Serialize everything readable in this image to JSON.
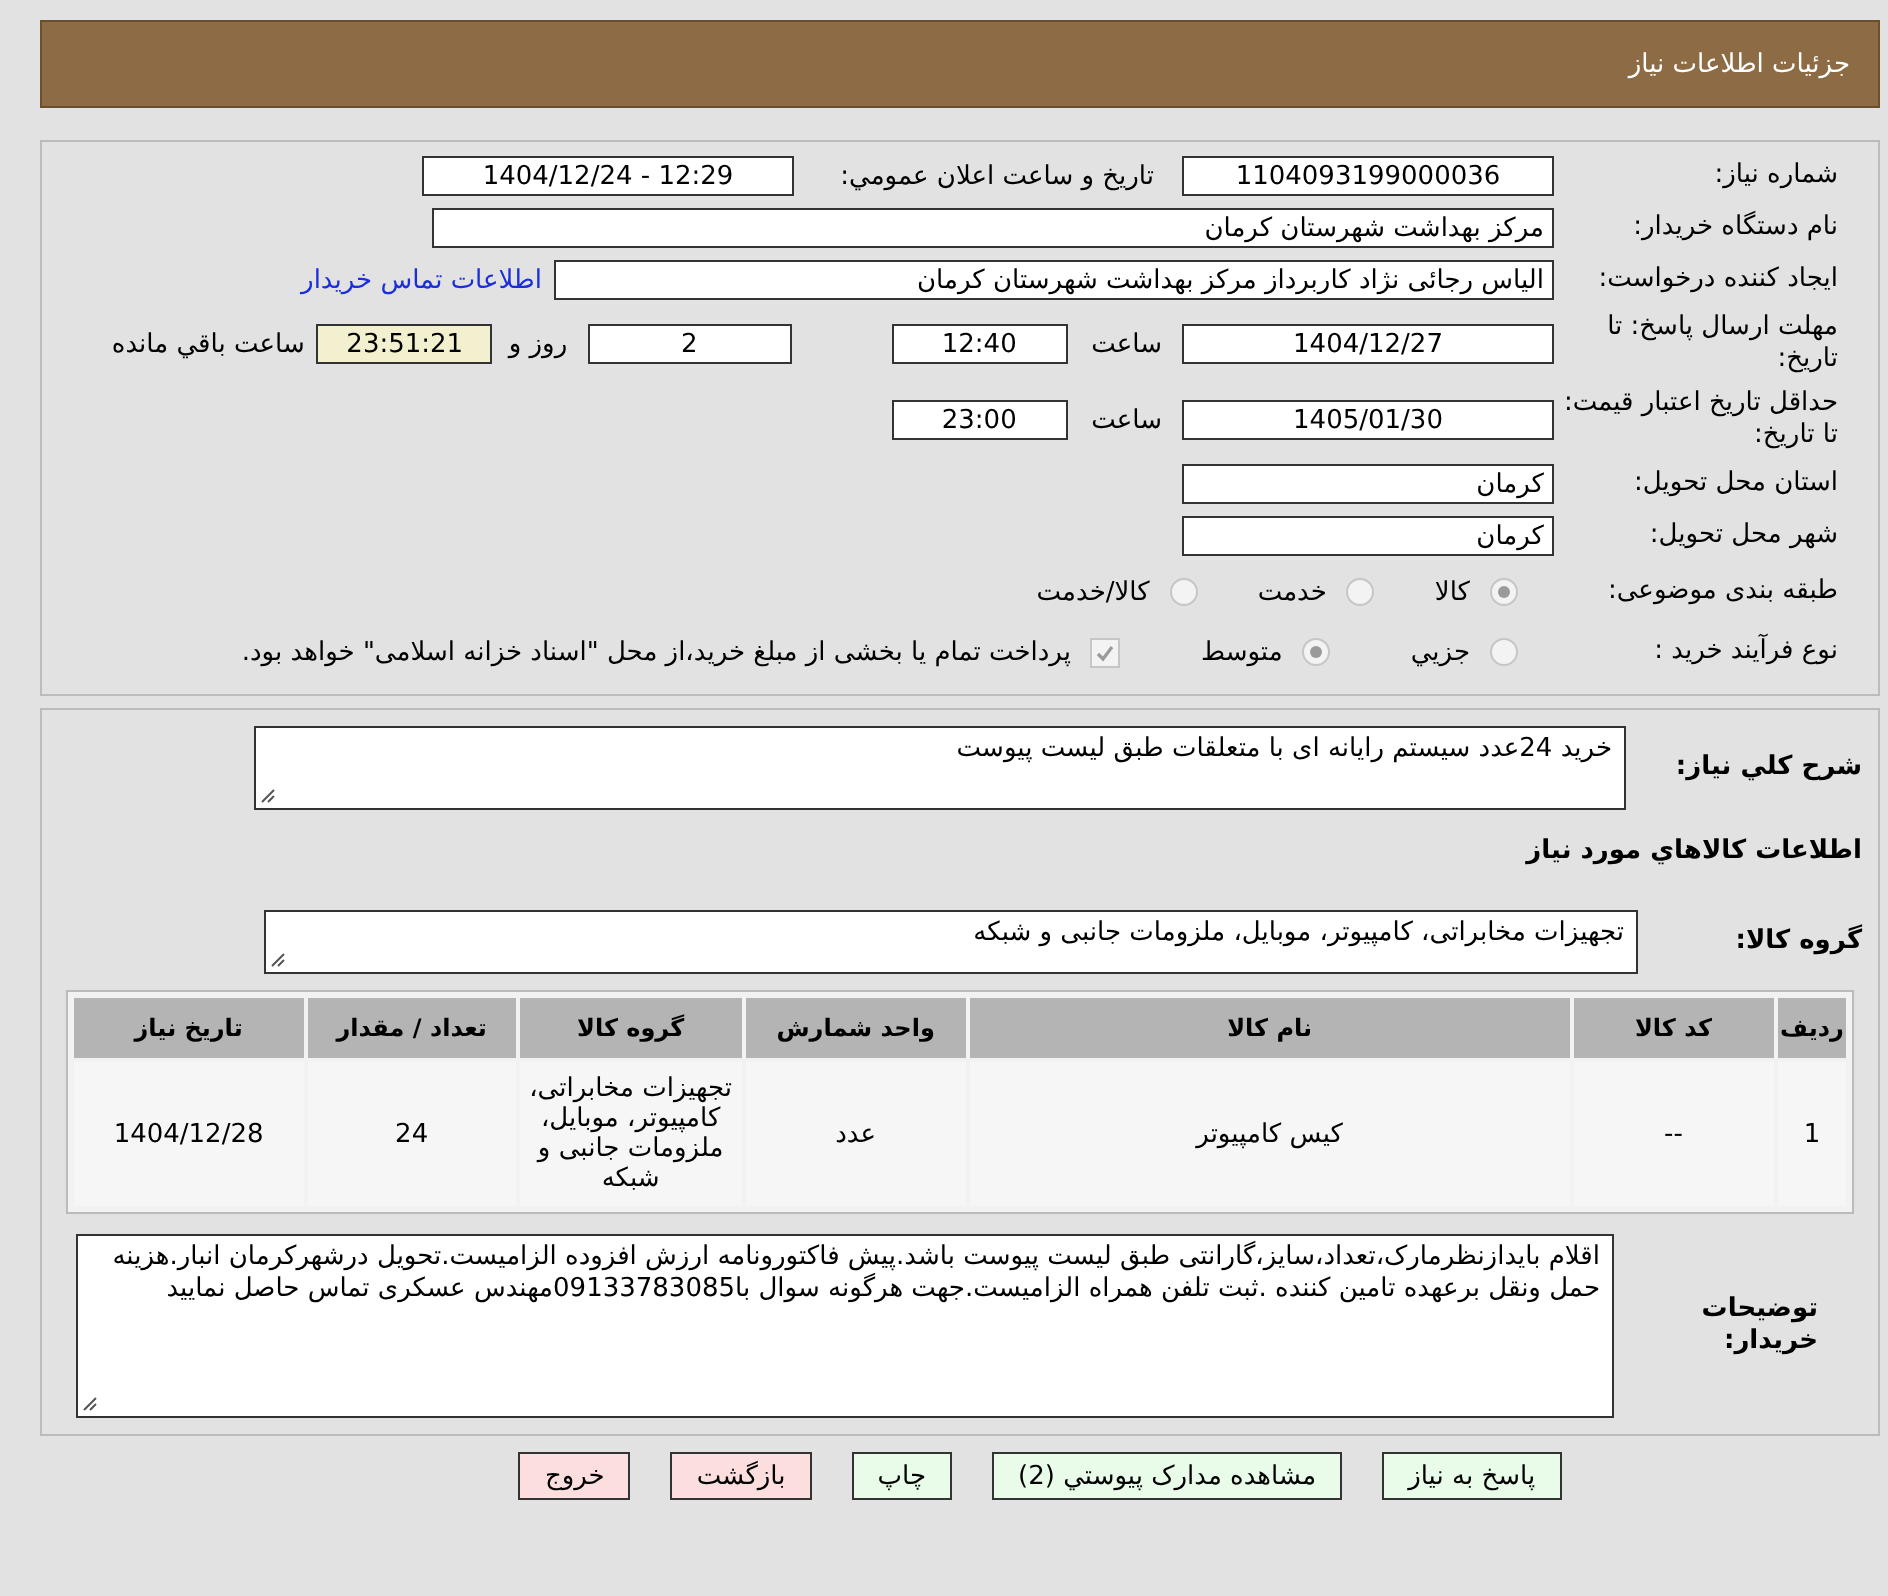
{
  "header": {
    "title": "جزئیات اطلاعات نیاز"
  },
  "need_number": {
    "label": "شماره نیاز:",
    "value": "1104093199000036"
  },
  "announce": {
    "label": "تاريخ و ساعت اعلان عمومي:",
    "value": "1404/12/24 - 12:29"
  },
  "buyer_org": {
    "label": "نام دستگاه خریدار:",
    "value": "مرکز بهداشت شهرستان کرمان"
  },
  "requester": {
    "label": "ایجاد کننده درخواست:",
    "value": "الیاس رجائی نژاد کاربرداز مرکز بهداشت شهرستان کرمان",
    "link": "اطلاعات تماس خریدار"
  },
  "deadline": {
    "label": "مهلت ارسال پاسخ: تا تاریخ:",
    "date": "1404/12/27",
    "time_label": "ساعت",
    "time": "12:40",
    "days": "2",
    "days_label": "روز و",
    "remaining": "23:51:21",
    "remaining_label": "ساعت باقي مانده"
  },
  "validity": {
    "label": "حداقل تاریخ اعتبار قیمت: تا تاریخ:",
    "date": "1405/01/30",
    "time_label": "ساعت",
    "time": "23:00"
  },
  "province": {
    "label": "استان محل تحویل:",
    "value": "کرمان"
  },
  "city": {
    "label": "شهر محل تحویل:",
    "value": "کرمان"
  },
  "category": {
    "label": "طبقه بندی موضوعی:",
    "options": [
      {
        "label": "کالا",
        "selected": true
      },
      {
        "label": "خدمت",
        "selected": false
      },
      {
        "label": "کالا/خدمت",
        "selected": false
      }
    ]
  },
  "process": {
    "label": "نوع فرآیند خرید :",
    "options": [
      {
        "label": "جزيي",
        "selected": false
      },
      {
        "label": "متوسط",
        "selected": true
      }
    ],
    "treasury": {
      "checked": true,
      "text": "پرداخت تمام یا بخشی از مبلغ خرید،از محل \"اسناد خزانه اسلامی\" خواهد بود."
    }
  },
  "summary": {
    "label": "شرح كلي نياز:",
    "value": "خرید 24عدد سیستم رایانه ای با متعلقات طبق لیست پیوست"
  },
  "goods_heading": "اطلاعات كالاهاي مورد نياز",
  "goods_group": {
    "label": "گروه کالا:",
    "value": "تجهیزات مخابراتی، کامپیوتر، موبایل، ملزومات جانبی و شبکه"
  },
  "table": {
    "columns": [
      "ردیف",
      "کد کالا",
      "نام کالا",
      "واحد شمارش",
      "گروه کالا",
      "تعداد / مقدار",
      "تاریخ نیاز"
    ],
    "rows": [
      [
        "1",
        "--",
        "کیس کامپیوتر",
        "عدد",
        "تجهیزات مخابراتی، کامپیوتر، موبایل، ملزومات جانبی و شبکه",
        "24",
        "1404/12/28"
      ]
    ]
  },
  "notes": {
    "label": "توضیحات خریدار:",
    "value": "اقلام بایدازنظرمارک،تعداد،سایز،گارانتی طبق لیست پیوست باشد.پیش فاکتورونامه ارزش افزوده الزامیست.تحویل درشهرکرمان انبار.هزینه حمل ونقل برعهده تامین کننده .ثبت تلفن همراه الزامیست.جهت هرگونه سوال با09133783085مهندس عسکری تماس حاصل نمایید"
  },
  "buttons": [
    {
      "label": "پاسخ به نياز",
      "kind": "action"
    },
    {
      "label": "مشاهده مدارک پیوستي (2)",
      "kind": "action"
    },
    {
      "label": "چاپ",
      "kind": "action"
    },
    {
      "label": "بازگشت",
      "kind": "exit"
    },
    {
      "label": "خروج",
      "kind": "exit"
    }
  ]
}
